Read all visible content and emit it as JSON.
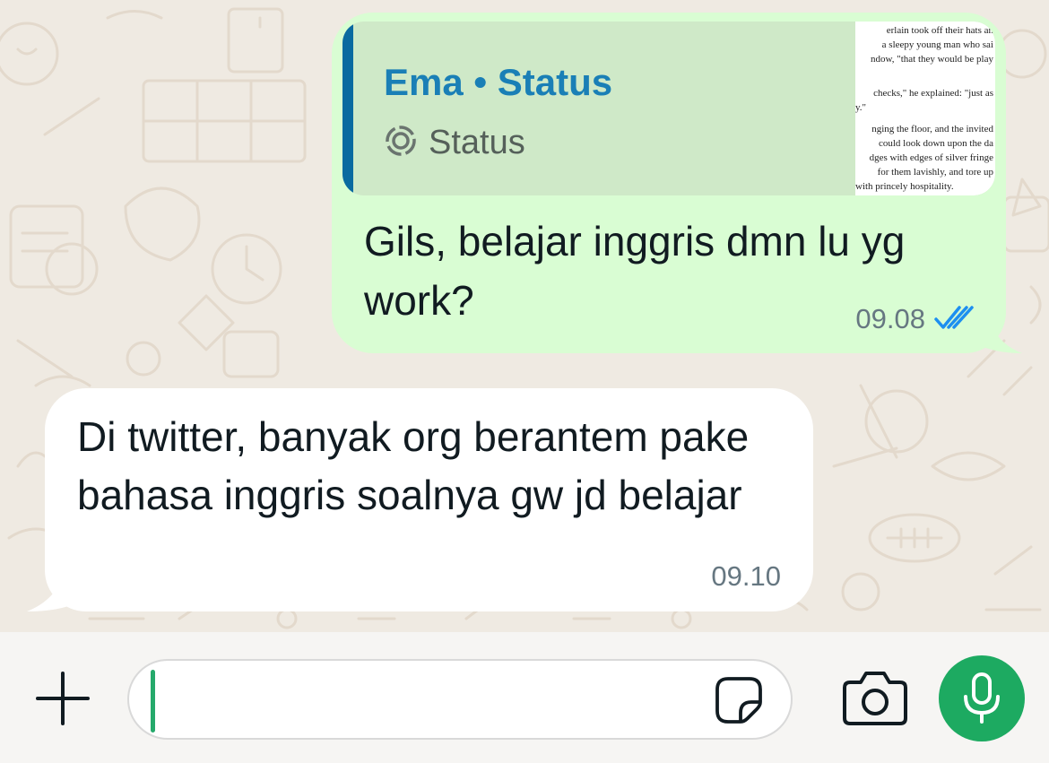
{
  "colors": {
    "chat_background": "#efeae2",
    "outgoing_bubble": "#d9fdd3",
    "incoming_bubble": "#ffffff",
    "reply_accent": "#0a6aa0",
    "reply_author": "#1a7fb6",
    "read_ticks": "#1d8ff0",
    "mic_button": "#1daa61"
  },
  "messages": [
    {
      "direction": "outgoing",
      "reply": {
        "author": "Ema • Status",
        "kind_label": "Status",
        "kind_icon": "status-icon",
        "thumbnail_lines": [
          "erlain took off their hats an",
          "a sleepy young man who sai",
          "ndow, \"that they would be play",
          "checks,\" he explained: \"just as",
          "y.\"",
          "nging the floor, and the invited",
          "could look down upon the da",
          "dges with edges of silver fringe",
          "for them lavishly, and tore up",
          "with princely hospitality."
        ]
      },
      "text": "Gils, belajar inggris dmn lu yg work?",
      "time": "09.08",
      "status_icon": "double-check-read-icon"
    },
    {
      "direction": "incoming",
      "text": "Di twitter, banyak org berantem pake bahasa inggris soalnya gw jd belajar",
      "time": "09.10"
    }
  ],
  "input_bar": {
    "attach_icon": "plus-icon",
    "input_value": "",
    "sticker_icon": "sticker-icon",
    "camera_icon": "camera-icon",
    "mic_icon": "mic-icon"
  }
}
